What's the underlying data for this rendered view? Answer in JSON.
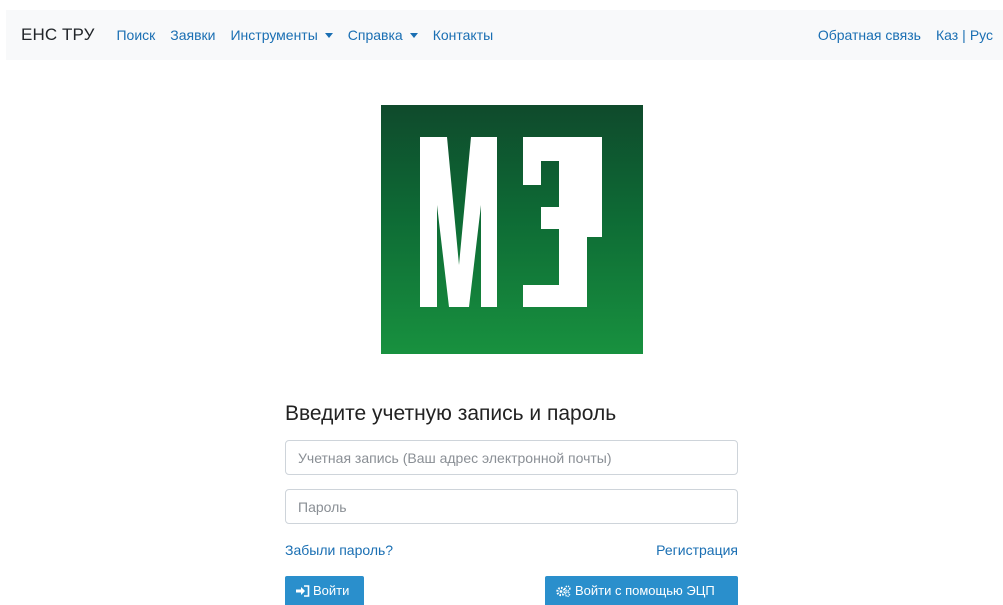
{
  "navbar": {
    "brand": "ЕНС ТРУ",
    "links": [
      {
        "label": "Поиск"
      },
      {
        "label": "Заявки"
      },
      {
        "label": "Инструменты"
      },
      {
        "label": "Справка"
      },
      {
        "label": "Контакты"
      }
    ],
    "feedback": "Обратная связь",
    "lang": {
      "kaz": "Каз",
      "separator": "|",
      "rus": "Рус"
    }
  },
  "logo": {
    "text": "МЗ",
    "colors": {
      "top": "#0f4a2c",
      "bottom": "#18913f",
      "letters": "#ffffff"
    }
  },
  "login": {
    "title": "Введите учетную запись и пароль",
    "username_placeholder": "Учетная запись (Ваш адрес электронной почты)",
    "username_value": "",
    "password_placeholder": "Пароль",
    "password_value": "",
    "forgot_link": "Забыли пароль?",
    "register_link": "Регистрация",
    "login_button": "Войти",
    "eds_button": "Войти с помощью ЭЦП"
  },
  "colors": {
    "link": "#1a6fb3",
    "button": "#2a8fcc",
    "navbar_bg": "#f8f9fa"
  },
  "icons": {
    "login": "sign-in-icon",
    "eds": "cogs-icon",
    "dropdown": "caret-down-icon"
  }
}
